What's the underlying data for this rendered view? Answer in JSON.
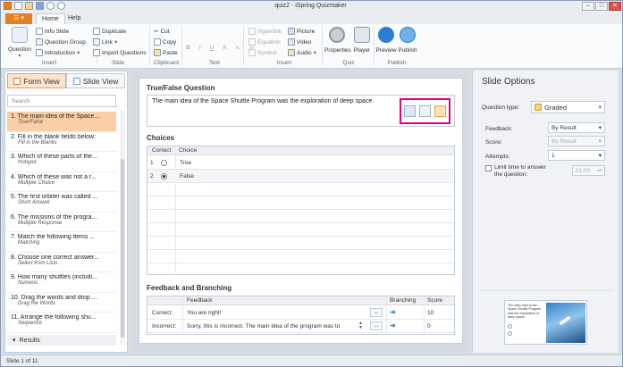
{
  "title_bar": {
    "title": "quiz2 - iSpring Quizmaker",
    "minimize": "–",
    "maximize": "□",
    "close": "✕"
  },
  "menu": {
    "file_label": "☰ ▾",
    "tabs": [
      "Home",
      "Help"
    ]
  },
  "ribbon": {
    "insert": {
      "question_label": "Question",
      "info_slide": "Info Slide",
      "question_group": "Question Group",
      "introduction": "Introduction",
      "group_label": "Insert"
    },
    "slide": {
      "duplicate": "Duplicate",
      "link": "Link",
      "import_questions": "Import Questions",
      "group_label": "Slide"
    },
    "clipboard": {
      "cut": "Cut",
      "copy": "Copy",
      "paste": "Paste",
      "group_label": "Clipboard"
    },
    "text": {
      "bold": "B",
      "italic": "I",
      "underline": "U",
      "clear": "A",
      "subscript": "x₂",
      "superscript": "x²",
      "group_label": "Text"
    },
    "insert2": {
      "hyperlink": "Hyperlink",
      "equation": "Equation",
      "symbol": "Symbol",
      "picture": "Picture",
      "video": "Video",
      "audio": "Audio",
      "group_label": "Insert"
    },
    "quiz": {
      "properties": "Properties",
      "player": "Player",
      "group_label": "Quiz"
    },
    "publish": {
      "preview": "Preview",
      "publish": "Publish",
      "group_label": "Publish"
    }
  },
  "left_panel": {
    "form_view": "Form View",
    "slide_view": "Slide View",
    "search_placeholder": "Search",
    "slides": [
      {
        "title": "1.  The main idea of the Space...",
        "type": "True/False"
      },
      {
        "title": "2.  Fill in the blank fields below:",
        "type": "Fill in the Blanks"
      },
      {
        "title": "3.  Which of these parts of the...",
        "type": "Hotspot"
      },
      {
        "title": "4.  Which of these was not a r...",
        "type": "Multiple Choice"
      },
      {
        "title": "5.  The first orbiter was called ...",
        "type": "Short Answer"
      },
      {
        "title": "6.  The missions of the progra...",
        "type": "Multiple Response"
      },
      {
        "title": "7.  Match the following items ...",
        "type": "Matching"
      },
      {
        "title": "8.  Choose one correct answer...",
        "type": "Select from Lists"
      },
      {
        "title": "9.  How many shuttles (includi...",
        "type": "Numeric"
      },
      {
        "title": "10.  Drag the words and drop ...",
        "type": "Drag the Words"
      },
      {
        "title": "11.  Arrange the following shu...",
        "type": "Sequence"
      }
    ],
    "results_label": "Results"
  },
  "main": {
    "question_header": "True/False Question",
    "question_text": "The main idea of the Space Shuttle Program was the exploration of deep space.",
    "choices_header": "Choices",
    "choices_columns": [
      "Correct",
      "Choice"
    ],
    "choices": [
      {
        "index": "1",
        "text": "True"
      },
      {
        "index": "2",
        "text": "False"
      }
    ],
    "feedback_header": "Feedback and Branching",
    "feedback_columns": [
      "Feedback",
      "Branching",
      "Score"
    ],
    "feedback_rows": [
      {
        "label": "Correct:",
        "text": "You are right!",
        "score": "10"
      },
      {
        "label": "Incorrect:",
        "text": "Sorry, this is incorrect. The main idea of the program was to",
        "score": "0"
      }
    ],
    "more_label": "...",
    "branch_arrow": "➜"
  },
  "right_panel": {
    "title": "Slide Options",
    "question_type_label": "Question type:",
    "question_type_value": "Graded",
    "feedback_label": "Feedback:",
    "feedback_value": "By Result",
    "score_label": "Score:",
    "score_value": "By Result",
    "attempts_label": "Attempts:",
    "attempts_value": "1",
    "limit_label": "Limit time to answer the question:",
    "limit_value": "01:00",
    "thumb_text": "The main idea of the Space Shuttle Program was the exploration of deep space."
  },
  "status_bar": {
    "text": "Slide 1 of 11"
  },
  "colors": {
    "accent": "#e67e22",
    "highlight": "#e0008a",
    "selected": "#f9cfa8",
    "link": "#2a7fd4"
  }
}
